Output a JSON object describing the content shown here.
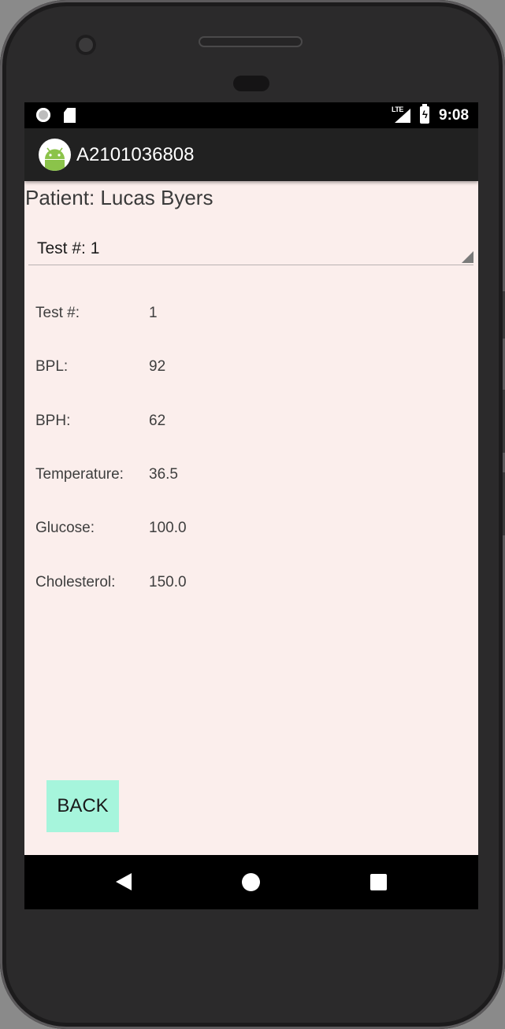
{
  "status_bar": {
    "network": "LTE",
    "time": "9:08"
  },
  "app_bar": {
    "title": "A2101036808",
    "icon": "android-icon"
  },
  "patient": {
    "text": "Patient: Lucas Byers"
  },
  "spinner": {
    "selected": "Test #: 1"
  },
  "details": [
    {
      "label": "Test #:",
      "value": "1"
    },
    {
      "label": "BPL:",
      "value": "92"
    },
    {
      "label": "BPH:",
      "value": "62"
    },
    {
      "label": "Temperature:",
      "value": "36.5"
    },
    {
      "label": "Glucose:",
      "value": "100.0"
    },
    {
      "label": "Cholesterol:",
      "value": "150.0"
    }
  ],
  "back_button": {
    "label": "BACK",
    "color": "#a6f5dc"
  },
  "nav_bar": {
    "back_icon": "nav-back-icon",
    "home_icon": "nav-home-icon",
    "recents_icon": "nav-recents-icon"
  },
  "colors": {
    "screen_background": "#fbeeec",
    "app_bar": "#212121",
    "status_bar": "#000000"
  }
}
